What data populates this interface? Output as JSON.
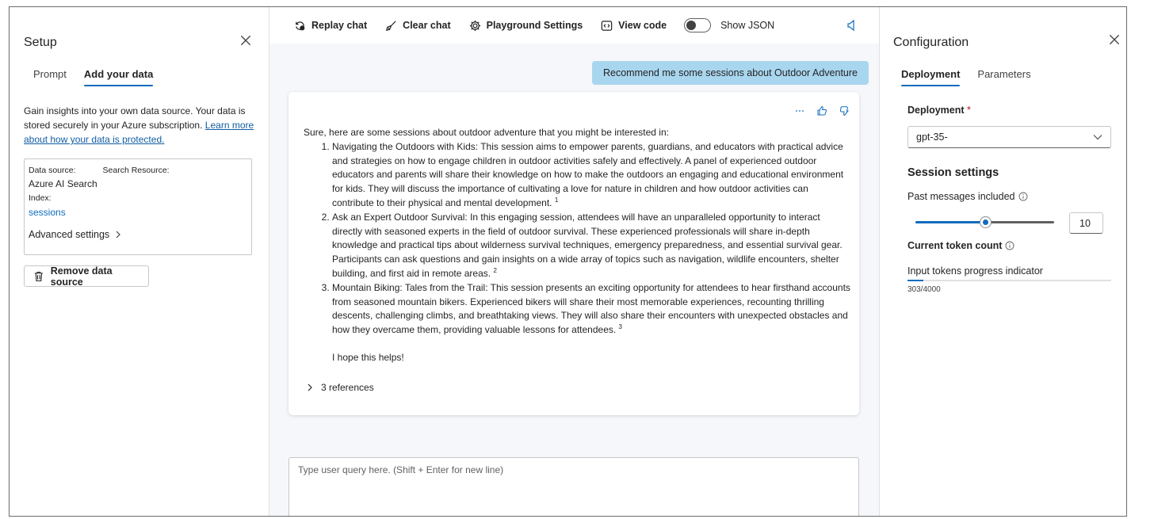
{
  "setup": {
    "title": "Setup",
    "tabs": [
      "Prompt",
      "Add your data"
    ],
    "active_tab": "Add your data",
    "description": "Gain insights into your own data source. Your data is stored securely in your Azure subscription.",
    "learn_link": "Learn more about how your data is protected.",
    "data_source_label": "Data source:",
    "search_resource_label": "Search Resource:",
    "data_source_value": "Azure AI Search",
    "index_label": "Index:",
    "index_value": "sessions",
    "advanced_settings": "Advanced settings",
    "remove_button": "Remove data source"
  },
  "toolbar": {
    "replay": "Replay chat",
    "clear": "Clear chat",
    "settings": "Playground Settings",
    "view_code": "View code",
    "show_json": "Show JSON",
    "show_json_on": false
  },
  "chat": {
    "user_message": "Recommend me some sessions about Outdoor Adventure",
    "intro": "Sure, here are some sessions about outdoor adventure that you might be interested in:",
    "items": [
      {
        "text": "Navigating the Outdoors with Kids: This session aims to empower parents, guardians, and educators with practical advice and strategies on how to engage children in outdoor activities safely and effectively. A panel of experienced outdoor educators and parents will share their knowledge on how to make the outdoors an engaging and educational environment for kids. They will discuss the importance of cultivating a love for nature in children and how outdoor activities can contribute to their physical and mental development.",
        "ref": "1"
      },
      {
        "text": "Ask an Expert Outdoor Survival: In this engaging session, attendees will have an unparalleled opportunity to interact directly with seasoned experts in the field of outdoor survival. These experienced professionals will share in-depth knowledge and practical tips about wilderness survival techniques, emergency preparedness, and essential survival gear. Participants can ask questions and gain insights on a wide array of topics such as navigation, wildlife encounters, shelter building, and first aid in remote areas.",
        "ref": "2"
      },
      {
        "text": "Mountain Biking: Tales from the Trail: This session presents an exciting opportunity for attendees to hear firsthand accounts from seasoned mountain bikers. Experienced bikers will share their most memorable experiences, recounting thrilling descents, challenging climbs, and breathtaking views. They will also share their encounters with unexpected obstacles and how they overcame them, providing valuable lessons for attendees.",
        "ref": "3"
      }
    ],
    "closing": "I hope this helps!",
    "references": "3 references",
    "input_placeholder": "Type user query here. (Shift + Enter for new line)"
  },
  "config": {
    "title": "Configuration",
    "tabs": [
      "Deployment",
      "Parameters"
    ],
    "active_tab": "Deployment",
    "deployment_label": "Deployment",
    "required_mark": "*",
    "deployment_value": "gpt-35-",
    "session_title": "Session settings",
    "past_messages_label": "Past messages included",
    "past_messages_value": "10",
    "past_messages_fraction": 0.5,
    "token_count_label": "Current token count",
    "progress_label": "Input tokens progress indicator",
    "progress_text": "303/4000",
    "progress_fraction": 0.076
  },
  "colors": {
    "accent": "#0f6cbd",
    "user_bubble": "#a9d6ef",
    "chat_bg": "#f5f7fb"
  }
}
